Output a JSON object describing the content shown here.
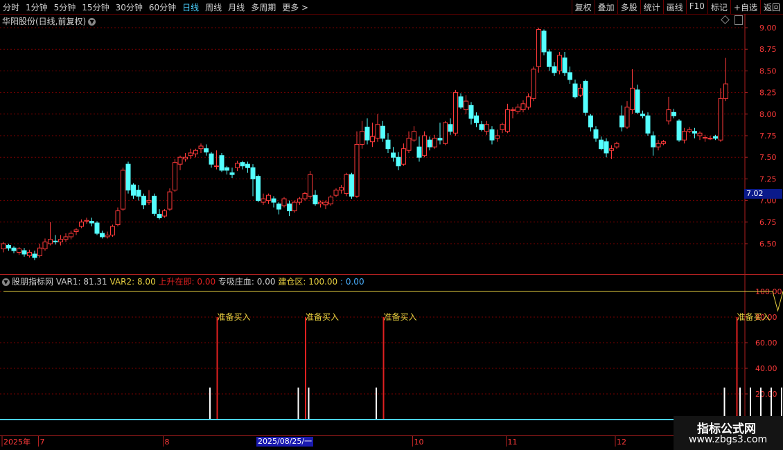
{
  "toolbar": {
    "periods": [
      "分时",
      "1分钟",
      "5分钟",
      "15分钟",
      "30分钟",
      "60分钟",
      "日线",
      "周线",
      "月线",
      "多周期",
      "更多 >"
    ],
    "active_period": "日线",
    "tools": [
      "复权",
      "叠加",
      "多股",
      "统计",
      "画线",
      "F10",
      "标记",
      "+自选",
      "返回"
    ]
  },
  "stock": {
    "title": "华阳股份(日线,前复权)"
  },
  "price_tag": "7.02",
  "indicator": {
    "name": "股朋指标网",
    "items": [
      {
        "text": "VAR1: 81.31",
        "color": "#d0d0d0"
      },
      {
        "text": "VAR2: 8.00",
        "color": "#e8d040"
      },
      {
        "text": "上升在即: 0.00",
        "color": "#e02020"
      },
      {
        "text": "专吸庄血: 0.00",
        "color": "#d0d0d0"
      },
      {
        "text": "建仓区: 100.00",
        "color": "#e8d040"
      },
      {
        "text": ": 0.00",
        "color": "#4ab0ff"
      }
    ]
  },
  "date_cursor": "2025/08/25/一",
  "watermark": {
    "line1": "指标公式网",
    "line2": "www.zbgs3.com"
  },
  "colors": {
    "up": "#ff3a3a",
    "down": "#54ffff",
    "grid": "#7a0000",
    "yellow": "#e8d040",
    "axis": "#b02020"
  },
  "chart_data": [
    {
      "type": "candlestick",
      "title": "华阳股份(日线,前复权)",
      "yticks": [
        6.5,
        6.75,
        7.0,
        7.25,
        7.5,
        7.75,
        8.0,
        8.25,
        8.5,
        8.75,
        9.0
      ],
      "ylim": [
        6.33,
        9.1
      ],
      "x_labels": [
        "2025年",
        "7",
        "8",
        "9",
        "10",
        "11",
        "12"
      ],
      "candles": [
        [
          6.44,
          6.5,
          6.52,
          6.4
        ],
        [
          6.48,
          6.45,
          6.5,
          6.42
        ],
        [
          6.45,
          6.42,
          6.47,
          6.39
        ],
        [
          6.4,
          6.44,
          6.46,
          6.37
        ],
        [
          6.42,
          6.38,
          6.45,
          6.35
        ],
        [
          6.36,
          6.4,
          6.43,
          6.34
        ],
        [
          6.38,
          6.34,
          6.42,
          6.31
        ],
        [
          6.36,
          6.45,
          6.5,
          6.34
        ],
        [
          6.44,
          6.52,
          6.56,
          6.42
        ],
        [
          6.5,
          6.55,
          6.75,
          6.48
        ],
        [
          6.53,
          6.52,
          6.6,
          6.49
        ],
        [
          6.52,
          6.55,
          6.6,
          6.48
        ],
        [
          6.55,
          6.58,
          6.62,
          6.52
        ],
        [
          6.58,
          6.62,
          6.65,
          6.55
        ],
        [
          6.64,
          6.66,
          6.68,
          6.6
        ],
        [
          6.7,
          6.75,
          6.78,
          6.68
        ],
        [
          6.76,
          6.77,
          6.8,
          6.73
        ],
        [
          6.76,
          6.74,
          6.8,
          6.7
        ],
        [
          6.74,
          6.62,
          6.76,
          6.6
        ],
        [
          6.62,
          6.58,
          6.65,
          6.56
        ],
        [
          6.58,
          6.6,
          6.64,
          6.56
        ],
        [
          6.6,
          6.7,
          6.72,
          6.58
        ],
        [
          6.72,
          6.88,
          6.92,
          6.7
        ],
        [
          6.9,
          7.35,
          7.38,
          6.88
        ],
        [
          7.42,
          7.12,
          7.45,
          7.08
        ],
        [
          7.18,
          7.06,
          7.2,
          7.02
        ],
        [
          7.12,
          7.05,
          7.18,
          7.0
        ],
        [
          7.05,
          6.95,
          7.08,
          6.9
        ],
        [
          6.98,
          7.0,
          7.12,
          6.95
        ],
        [
          7.05,
          6.85,
          7.08,
          6.82
        ],
        [
          6.84,
          6.8,
          6.9,
          6.78
        ],
        [
          6.82,
          6.88,
          6.9,
          6.8
        ],
        [
          6.9,
          7.1,
          7.14,
          6.88
        ],
        [
          7.12,
          7.44,
          7.48,
          7.1
        ],
        [
          7.42,
          7.5,
          7.52,
          7.35
        ],
        [
          7.48,
          7.5,
          7.55,
          7.45
        ],
        [
          7.52,
          7.55,
          7.6,
          7.48
        ],
        [
          7.54,
          7.58,
          7.6,
          7.5
        ],
        [
          7.6,
          7.63,
          7.66,
          7.55
        ],
        [
          7.6,
          7.56,
          7.65,
          7.52
        ],
        [
          7.54,
          7.42,
          7.56,
          7.38
        ],
        [
          7.4,
          7.4,
          7.58,
          7.36
        ],
        [
          7.52,
          7.35,
          7.55,
          7.33
        ],
        [
          7.38,
          7.35,
          7.4,
          7.3
        ],
        [
          7.32,
          7.3,
          7.38,
          7.26
        ],
        [
          7.38,
          7.43,
          7.46,
          7.34
        ],
        [
          7.44,
          7.4,
          7.46,
          7.36
        ],
        [
          7.42,
          7.38,
          7.45,
          7.32
        ],
        [
          7.38,
          7.25,
          7.42,
          7.05
        ],
        [
          7.28,
          7.0,
          7.3,
          6.98
        ],
        [
          6.98,
          7.02,
          7.08,
          6.95
        ],
        [
          7.0,
          7.06,
          7.08,
          6.96
        ],
        [
          7.02,
          6.98,
          7.05,
          6.92
        ],
        [
          6.96,
          6.9,
          6.98,
          6.84
        ],
        [
          6.94,
          7.02,
          7.04,
          6.92
        ],
        [
          6.96,
          6.88,
          7.0,
          6.82
        ],
        [
          6.88,
          6.98,
          7.0,
          6.86
        ],
        [
          6.98,
          7.02,
          7.04,
          6.95
        ],
        [
          7.02,
          7.08,
          7.1,
          7.0
        ],
        [
          7.05,
          7.3,
          7.34,
          7.02
        ],
        [
          7.06,
          6.96,
          7.12,
          6.94
        ],
        [
          6.96,
          6.98,
          7.0,
          6.92
        ],
        [
          6.95,
          6.98,
          7.0,
          6.9
        ],
        [
          6.96,
          7.04,
          7.06,
          6.94
        ],
        [
          7.06,
          7.12,
          7.14,
          7.04
        ],
        [
          7.12,
          7.15,
          7.18,
          7.08
        ],
        [
          7.08,
          7.3,
          7.32,
          7.05
        ],
        [
          7.3,
          7.05,
          7.32,
          7.02
        ],
        [
          7.05,
          7.65,
          7.8,
          7.03
        ],
        [
          7.65,
          7.8,
          7.92,
          7.6
        ],
        [
          7.85,
          7.7,
          7.95,
          7.65
        ],
        [
          7.68,
          7.74,
          7.9,
          7.62
        ],
        [
          7.72,
          7.88,
          8.0,
          7.68
        ],
        [
          7.86,
          7.72,
          7.92,
          7.68
        ],
        [
          7.7,
          7.6,
          7.78,
          7.55
        ],
        [
          7.55,
          7.5,
          7.62,
          7.45
        ],
        [
          7.5,
          7.4,
          7.56,
          7.35
        ],
        [
          7.42,
          7.6,
          7.66,
          7.4
        ],
        [
          7.58,
          7.72,
          7.8,
          7.55
        ],
        [
          7.7,
          7.8,
          7.86,
          7.68
        ],
        [
          7.62,
          7.5,
          7.74,
          7.45
        ],
        [
          7.52,
          7.75,
          7.8,
          7.5
        ],
        [
          7.7,
          7.62,
          7.74,
          7.58
        ],
        [
          7.62,
          7.72,
          7.76,
          7.6
        ],
        [
          7.72,
          7.7,
          7.9,
          7.65
        ],
        [
          7.66,
          7.9,
          7.92,
          7.64
        ],
        [
          7.88,
          7.8,
          7.95,
          7.76
        ],
        [
          7.78,
          8.25,
          8.28,
          7.75
        ],
        [
          8.2,
          8.08,
          8.24,
          8.06
        ],
        [
          8.05,
          8.15,
          8.22,
          8.0
        ],
        [
          8.1,
          7.95,
          8.14,
          7.88
        ],
        [
          7.98,
          7.9,
          8.02,
          7.85
        ],
        [
          7.88,
          7.82,
          7.92,
          7.8
        ],
        [
          7.8,
          7.88,
          7.92,
          7.76
        ],
        [
          7.82,
          7.7,
          7.86,
          7.65
        ],
        [
          7.72,
          7.75,
          7.82,
          7.68
        ],
        [
          7.82,
          7.88,
          7.9,
          7.78
        ],
        [
          7.8,
          8.05,
          8.12,
          7.78
        ],
        [
          8.05,
          8.05,
          8.08,
          7.95
        ],
        [
          8.03,
          8.08,
          8.12,
          8.0
        ],
        [
          8.05,
          8.12,
          8.16,
          8.02
        ],
        [
          8.08,
          8.2,
          8.24,
          8.05
        ],
        [
          8.18,
          8.52,
          8.55,
          8.15
        ],
        [
          8.55,
          8.98,
          9.0,
          8.48
        ],
        [
          8.96,
          8.72,
          8.98,
          8.68
        ],
        [
          8.72,
          8.55,
          8.75,
          8.5
        ],
        [
          8.55,
          8.48,
          8.6,
          8.44
        ],
        [
          8.5,
          8.68,
          8.72,
          8.46
        ],
        [
          8.65,
          8.48,
          8.72,
          8.44
        ],
        [
          8.48,
          8.4,
          8.55,
          8.35
        ],
        [
          8.35,
          8.2,
          8.4,
          8.18
        ],
        [
          8.22,
          8.3,
          8.35,
          8.2
        ],
        [
          8.38,
          8.02,
          8.4,
          7.98
        ],
        [
          7.98,
          7.85,
          8.0,
          7.8
        ],
        [
          7.82,
          7.72,
          7.86,
          7.68
        ],
        [
          7.7,
          7.6,
          7.74,
          7.58
        ],
        [
          7.68,
          7.55,
          7.72,
          7.5
        ],
        [
          7.58,
          7.6,
          7.64,
          7.48
        ],
        [
          7.62,
          7.66,
          7.68,
          7.6
        ],
        [
          7.98,
          7.85,
          8.1,
          7.8
        ],
        [
          7.85,
          8.08,
          8.15,
          7.83
        ],
        [
          8.05,
          8.3,
          8.52,
          8.0
        ],
        [
          8.28,
          8.02,
          8.34,
          8.0
        ],
        [
          8.0,
          7.98,
          8.04,
          7.95
        ],
        [
          7.98,
          7.78,
          8.02,
          7.75
        ],
        [
          7.75,
          7.62,
          7.8,
          7.52
        ],
        [
          7.62,
          7.66,
          7.7,
          7.58
        ],
        [
          7.66,
          7.68,
          7.7,
          7.64
        ],
        [
          7.92,
          8.05,
          8.2,
          7.88
        ],
        [
          8.02,
          7.98,
          8.06,
          7.95
        ],
        [
          7.92,
          7.7,
          7.94,
          7.68
        ],
        [
          7.7,
          7.8,
          7.84,
          7.66
        ],
        [
          7.8,
          7.82,
          7.85,
          7.78
        ],
        [
          7.8,
          7.78,
          7.84,
          7.72
        ],
        [
          7.75,
          7.78,
          7.8,
          7.7
        ],
        [
          7.72,
          7.73,
          7.76,
          7.68
        ],
        [
          7.72,
          7.72,
          7.75,
          7.7
        ],
        [
          7.74,
          7.72,
          7.76,
          7.7
        ],
        [
          7.7,
          8.18,
          8.3,
          7.68
        ],
        [
          8.18,
          8.35,
          8.65,
          8.15
        ]
      ]
    },
    {
      "type": "bar",
      "title": "股朋指标网",
      "yticks": [
        20.0,
        40.0,
        60.0,
        80.0,
        100.0
      ],
      "ylim": [
        0,
        108
      ],
      "series": [
        {
          "name": "VAR1",
          "color": "#ffffff",
          "values": [
            [
              40,
              25
            ],
            [
              57,
              25
            ],
            [
              59,
              25
            ],
            [
              72,
              25
            ],
            [
              139,
              25
            ],
            [
              142,
              25
            ],
            [
              144,
              25
            ],
            [
              146,
              25
            ],
            [
              148,
              25
            ],
            [
              150,
              25
            ]
          ]
        },
        {
          "name": "上升在即",
          "color": "#e02020",
          "values": [
            [
              41,
              80
            ],
            [
              58,
              80
            ],
            [
              73,
              80
            ],
            [
              141,
              80
            ],
            [
              151,
              80
            ]
          ]
        },
        {
          "name": "建仓区",
          "color": "#e8d040",
          "values": [
            [
              0,
              100
            ],
            [
              146,
              100
            ],
            [
              148,
              100
            ],
            [
              149,
              85
            ],
            [
              150,
              100
            ],
            [
              180,
              100
            ]
          ]
        },
        {
          "name": "",
          "color": "#4ad0ff",
          "values": [
            0.0
          ]
        }
      ],
      "labels": [
        {
          "x": 41,
          "y": 80,
          "text": "准备买入"
        },
        {
          "x": 58,
          "y": 80,
          "text": "准备买入"
        },
        {
          "x": 73,
          "y": 80,
          "text": "准备买入"
        },
        {
          "x": 141,
          "y": 80,
          "text": "准备买入"
        },
        {
          "x": 151,
          "y": 80,
          "text": "准备买入"
        }
      ]
    }
  ]
}
